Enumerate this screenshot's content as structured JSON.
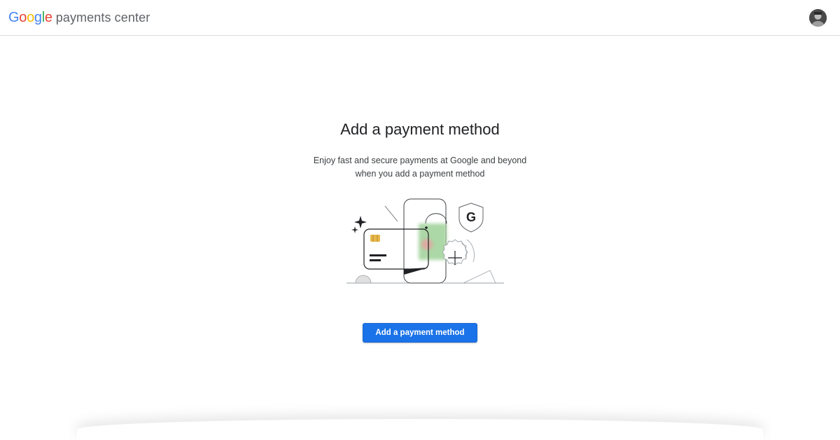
{
  "header": {
    "logo_letters": [
      "G",
      "o",
      "o",
      "g",
      "l",
      "e"
    ],
    "logo_colors": [
      "#4285F4",
      "#EA4335",
      "#FBBC05",
      "#4285F4",
      "#34A853",
      "#EA4335"
    ],
    "product_name": "payments center",
    "avatar_icon": "user-avatar"
  },
  "main": {
    "title": "Add a payment method",
    "description_line1": "Enjoy fast and secure payments at Google and beyond",
    "description_line2": "when you add a payment method",
    "illustration_icon": "payment-cards-illustration",
    "shield_letter": "G",
    "cta_label": "Add a payment method"
  },
  "colors": {
    "accent": "#1a73e8",
    "green_card": "#a8d5a2",
    "chip": "#e8b84a"
  }
}
